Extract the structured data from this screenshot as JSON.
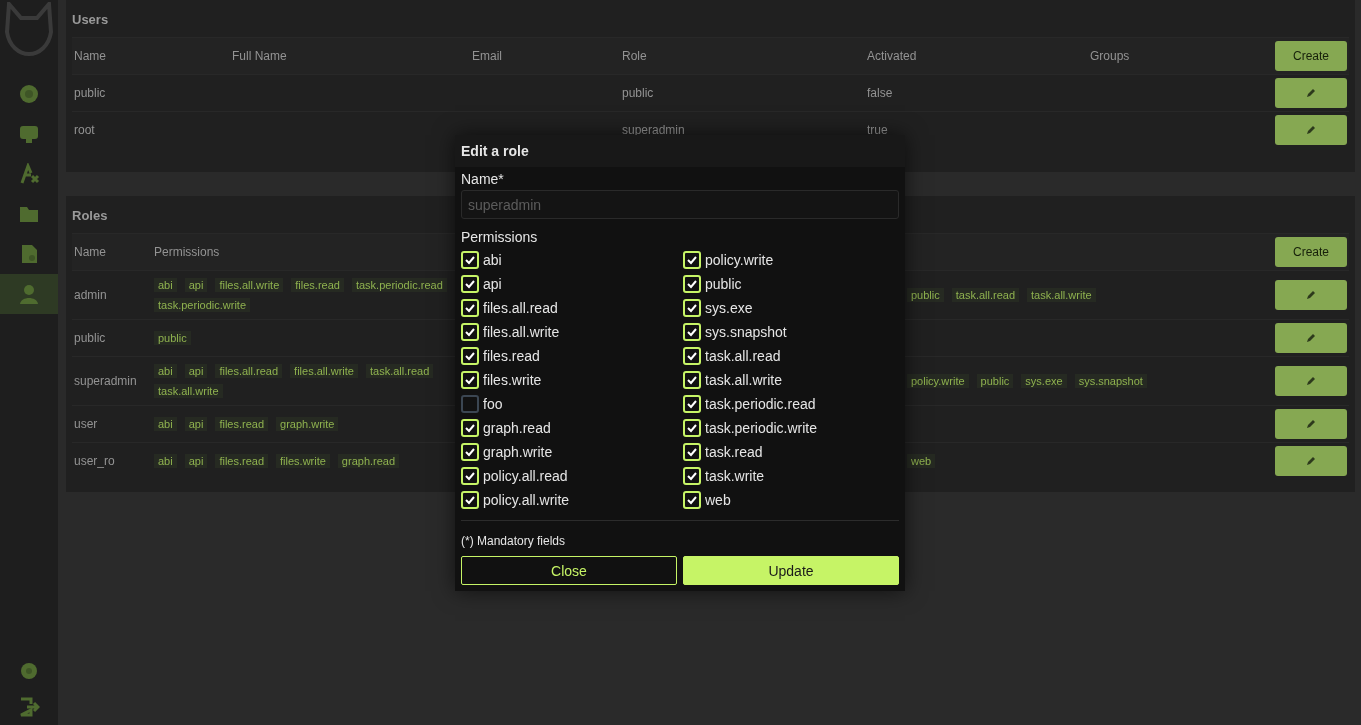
{
  "sidebar": {
    "items": [
      {
        "selected": false
      },
      {
        "selected": false
      },
      {
        "selected": false
      },
      {
        "selected": false
      },
      {
        "selected": false
      },
      {
        "selected": true
      }
    ]
  },
  "users": {
    "title": "Users",
    "columns": [
      "Name",
      "Full Name",
      "Email",
      "Role",
      "Activated",
      "Groups"
    ],
    "create_button": "Create",
    "rows": [
      {
        "name": "public",
        "role": "public",
        "activated": "false"
      },
      {
        "name": "root",
        "role": "superadmin",
        "activated": "true"
      }
    ]
  },
  "roles": {
    "title": "Roles",
    "columns": [
      "Name",
      "Permissions"
    ],
    "create_button": "Create",
    "rows": [
      {
        "name": "admin",
        "permissions_left": [
          "abi",
          "api",
          "files.all.write",
          "files.read",
          "task.periodic.read",
          "task.periodic.write"
        ],
        "permissions_right": [
          "public",
          "task.all.read",
          "task.all.write"
        ]
      },
      {
        "name": "public",
        "permissions_left": [
          "public"
        ],
        "permissions_right": []
      },
      {
        "name": "superadmin",
        "permissions_left": [
          "abi",
          "api",
          "files.all.read",
          "files.all.write",
          "task.all.read",
          "task.all.write"
        ],
        "permissions_right": [
          "policy.write",
          "public",
          "sys.exe",
          "sys.snapshot"
        ]
      },
      {
        "name": "user",
        "permissions_left": [
          "abi",
          "api",
          "files.read",
          "graph.write"
        ],
        "permissions_right": []
      },
      {
        "name": "user_ro",
        "permissions_left": [
          "abi",
          "api",
          "files.read",
          "files.write",
          "graph.read"
        ],
        "permissions_right": [
          "web"
        ]
      }
    ]
  },
  "dialog": {
    "title": "Edit a role",
    "name_label": "Name*",
    "name_field": {
      "value": "superadmin",
      "disabled": true
    },
    "permissions_label": "Permissions",
    "permissions": [
      {
        "label": "abi",
        "checked": true
      },
      {
        "label": "api",
        "checked": true
      },
      {
        "label": "files.all.read",
        "checked": true
      },
      {
        "label": "files.all.write",
        "checked": true
      },
      {
        "label": "files.read",
        "checked": true
      },
      {
        "label": "files.write",
        "checked": true
      },
      {
        "label": "foo",
        "checked": false
      },
      {
        "label": "graph.read",
        "checked": true
      },
      {
        "label": "graph.write",
        "checked": true
      },
      {
        "label": "policy.all.read",
        "checked": true
      },
      {
        "label": "policy.all.write",
        "checked": true
      },
      {
        "label": "policy.write",
        "checked": true
      },
      {
        "label": "public",
        "checked": true
      },
      {
        "label": "sys.exe",
        "checked": true
      },
      {
        "label": "sys.snapshot",
        "checked": true
      },
      {
        "label": "task.all.read",
        "checked": true
      },
      {
        "label": "task.all.write",
        "checked": true
      },
      {
        "label": "task.periodic.read",
        "checked": true
      },
      {
        "label": "task.periodic.write",
        "checked": true
      },
      {
        "label": "task.read",
        "checked": true
      },
      {
        "label": "task.write",
        "checked": true
      },
      {
        "label": "web",
        "checked": true
      }
    ],
    "note": "(*) Mandatory fields",
    "buttons": [
      {
        "label": "Close",
        "kind": "secondary"
      },
      {
        "label": "Update",
        "kind": "primary"
      }
    ]
  }
}
